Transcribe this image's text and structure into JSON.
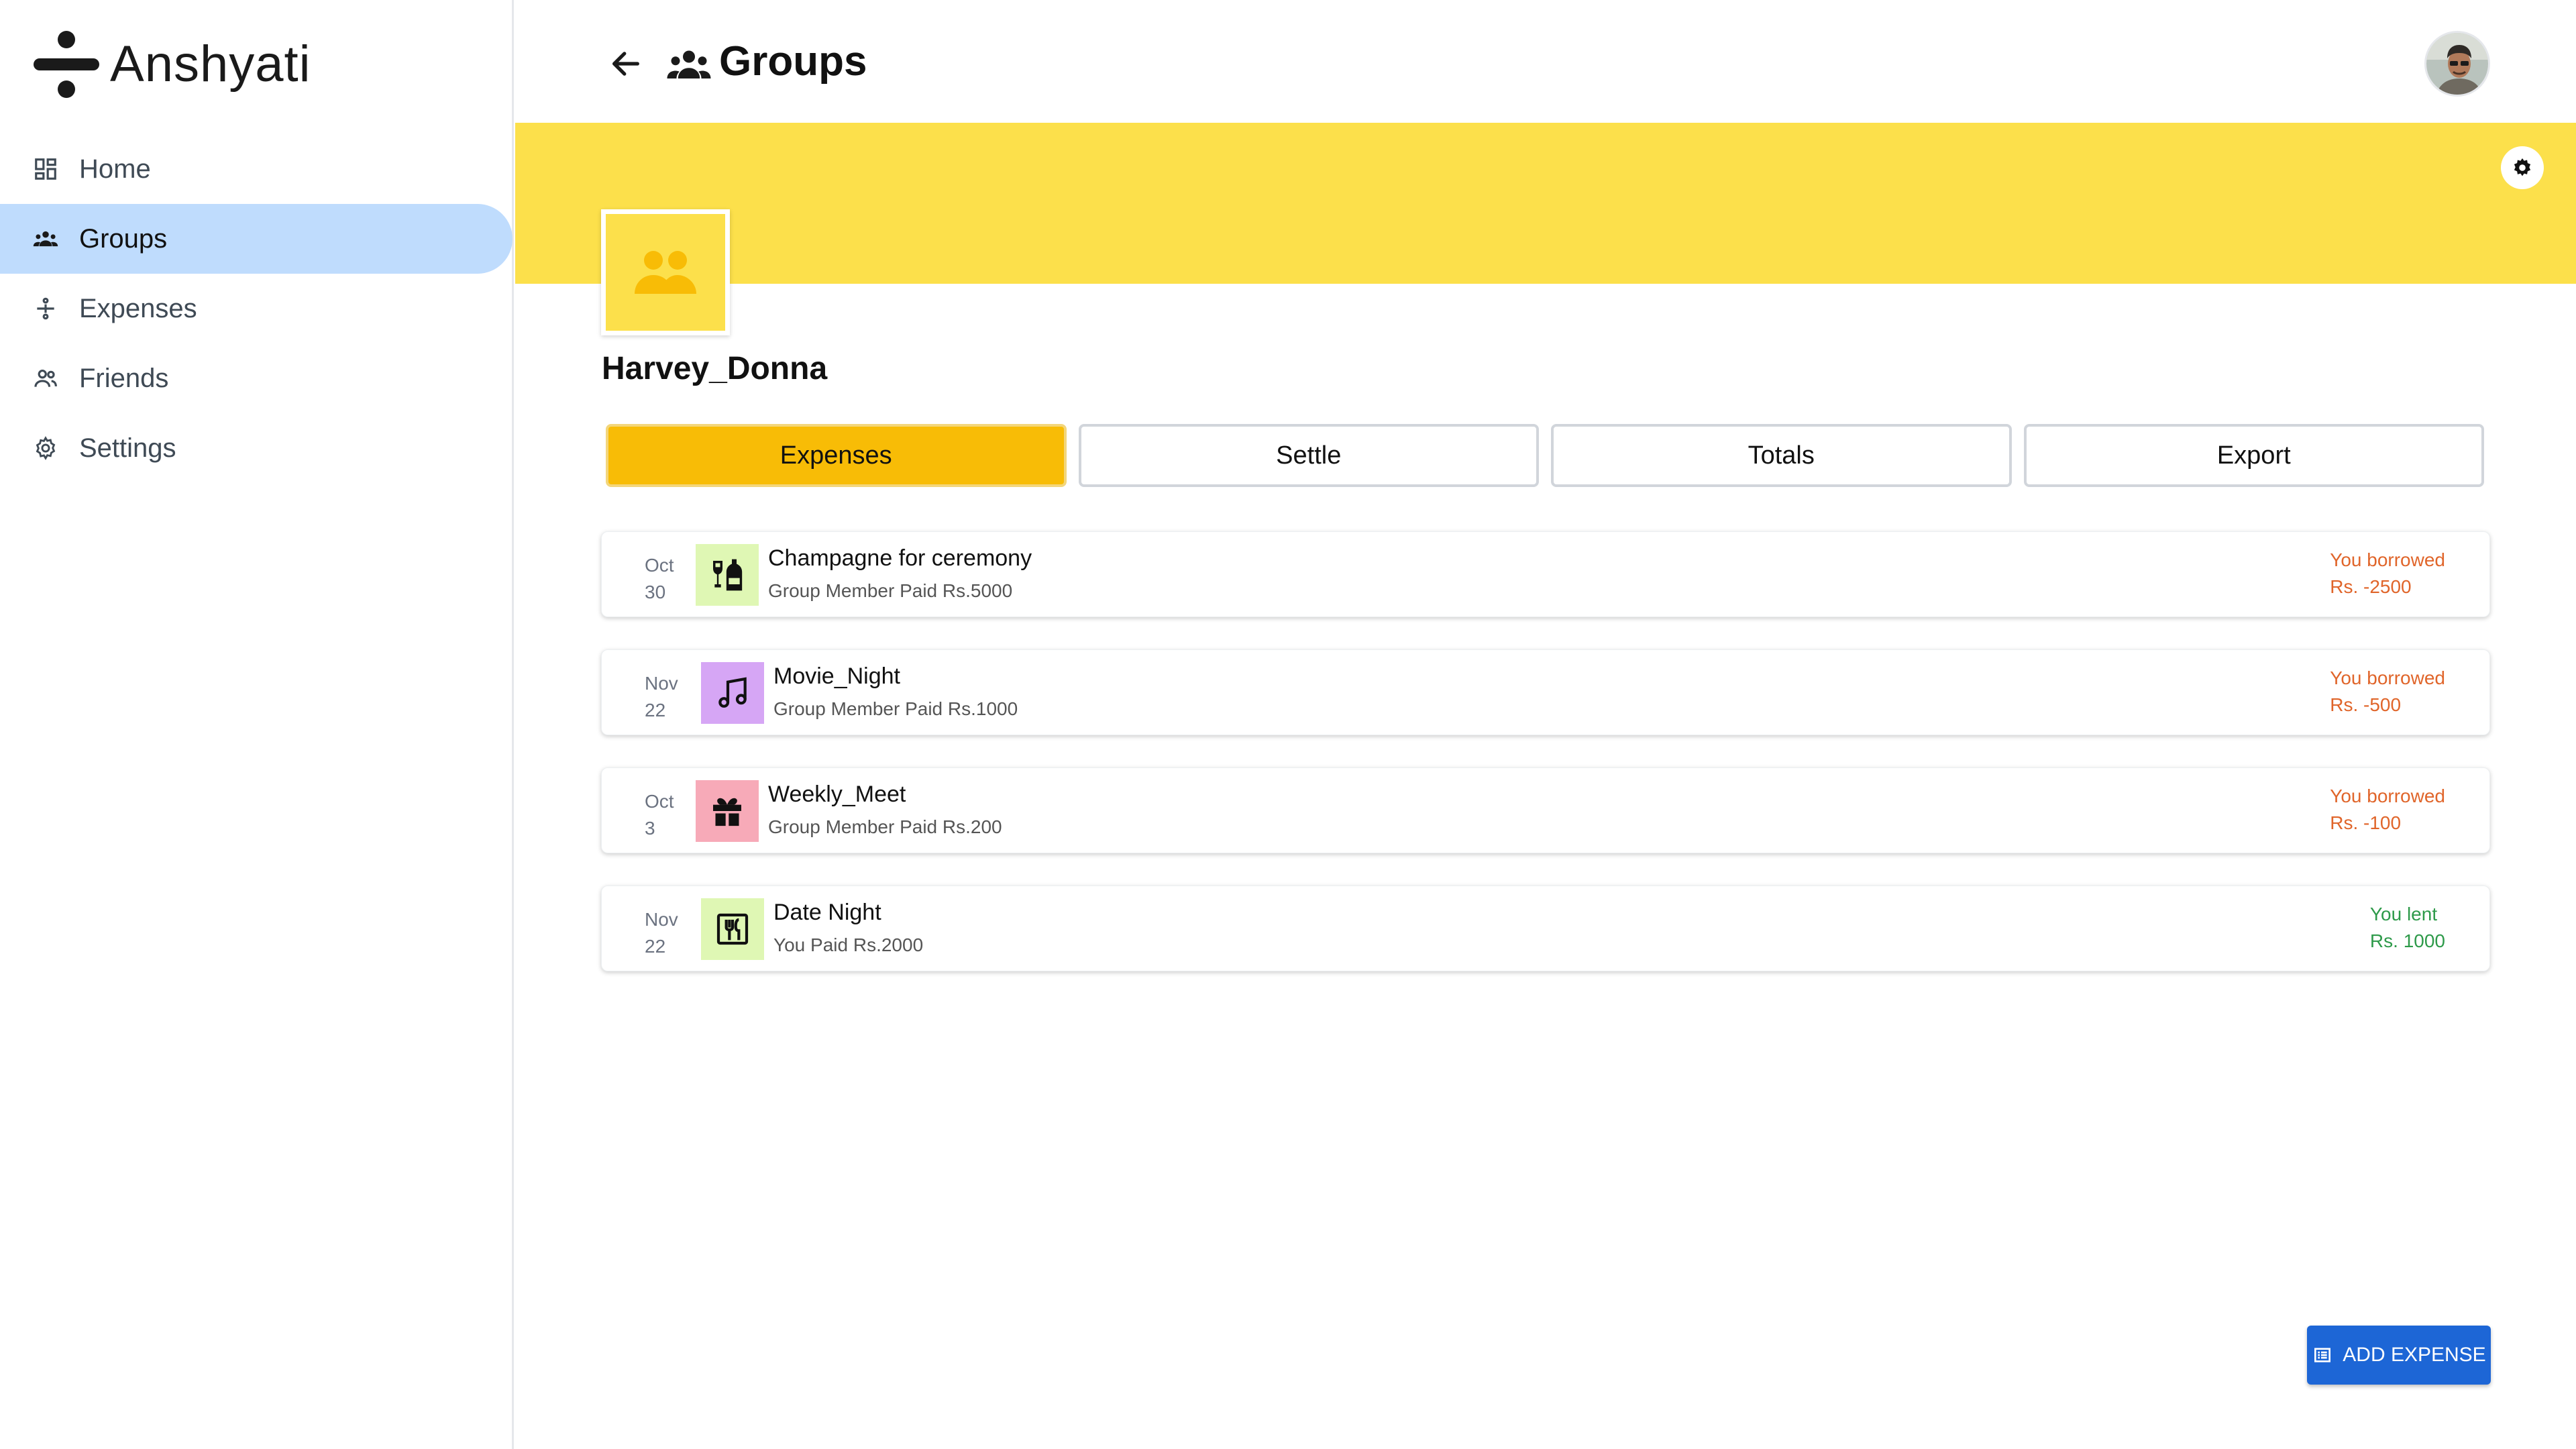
{
  "app": {
    "name": "Anshyati"
  },
  "sidebar": {
    "items": [
      {
        "label": "Home",
        "icon": "dashboard-icon",
        "active": false
      },
      {
        "label": "Groups",
        "icon": "groups-icon",
        "active": true
      },
      {
        "label": "Expenses",
        "icon": "expenses-icon",
        "active": false
      },
      {
        "label": "Friends",
        "icon": "friends-icon",
        "active": false
      },
      {
        "label": "Settings",
        "icon": "settings-icon",
        "active": false
      }
    ]
  },
  "header": {
    "title": "Groups",
    "back_icon": "arrow-back-icon",
    "title_icon": "groups-icon",
    "avatar_icon": "user-avatar"
  },
  "banner": {
    "color": "#fce04b",
    "settings_icon": "gear-icon"
  },
  "group": {
    "name": "Harvey_Donna",
    "icon": "people-icon"
  },
  "tabs": [
    {
      "label": "Expenses",
      "active": true
    },
    {
      "label": "Settle",
      "active": false
    },
    {
      "label": "Totals",
      "active": false
    },
    {
      "label": "Export",
      "active": false
    }
  ],
  "expenses": [
    {
      "month": "Oct",
      "day": "30",
      "icon": "champagne-icon",
      "icon_bg": "#dff7b4",
      "title": "Champagne for ceremony",
      "subtitle": "Group Member Paid Rs.5000",
      "status": "You borrowed",
      "amount": "Rs. -2500",
      "status_color": "#e0652a"
    },
    {
      "month": "Nov",
      "day": "22",
      "icon": "music-note-icon",
      "icon_bg": "#d6a6f5",
      "title": "Movie_Night",
      "subtitle": "Group Member Paid Rs.1000",
      "status": "You borrowed",
      "amount": "Rs. -500",
      "status_color": "#e0652a"
    },
    {
      "month": "Oct",
      "day": "3",
      "icon": "gift-icon",
      "icon_bg": "#f7aab8",
      "title": "Weekly_Meet",
      "subtitle": "Group Member Paid Rs.200",
      "status": "You borrowed",
      "amount": "Rs. -100",
      "status_color": "#e0652a"
    },
    {
      "month": "Nov",
      "day": "22",
      "icon": "restaurant-icon",
      "icon_bg": "#dff7b4",
      "title": "Date Night",
      "subtitle": "You Paid Rs.2000",
      "status": "You lent",
      "amount": "Rs. 1000",
      "status_color": "#2e9a4a"
    }
  ],
  "actions": {
    "add_expense": "ADD EXPENSE",
    "add_expense_icon": "receipt-list-icon"
  },
  "colors": {
    "active_nav": "#bfdcfd",
    "active_tab": "#f8bc06",
    "primary_button": "#1d66d6",
    "borrowed": "#e0652a",
    "lent": "#2e9a4a"
  }
}
